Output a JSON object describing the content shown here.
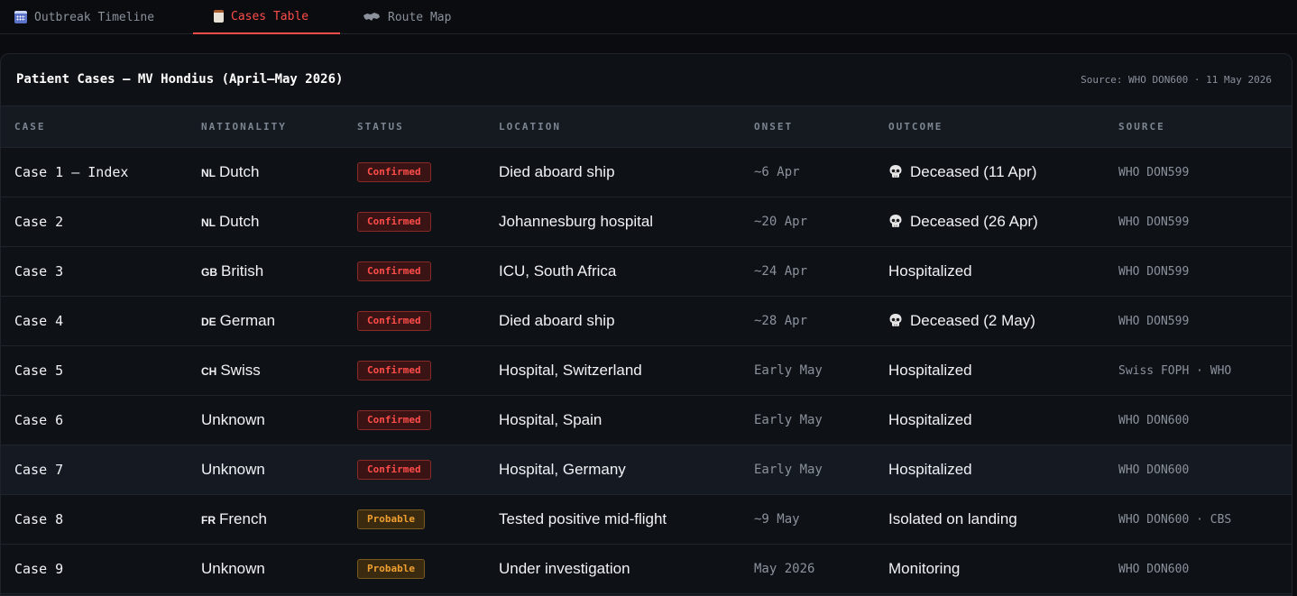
{
  "tabs": [
    {
      "label": "Outbreak Timeline",
      "icon": "calendar-icon",
      "active": false
    },
    {
      "label": "Cases Table",
      "icon": "clipboard-icon",
      "active": true
    },
    {
      "label": "Route Map",
      "icon": "map-icon",
      "active": false
    }
  ],
  "panel": {
    "title": "Patient Cases — MV Hondius (April–May 2026)",
    "source": "Source: WHO DON600 · 11 May 2026"
  },
  "table": {
    "headers": [
      "CASE",
      "NATIONALITY",
      "STATUS",
      "LOCATION",
      "ONSET",
      "OUTCOME",
      "SOURCE"
    ],
    "rows": [
      {
        "case": "Case 1 — Index",
        "flag": "NL",
        "nationality": "Dutch",
        "status": "Confirmed",
        "location": "Died aboard ship",
        "onset": "~6 Apr",
        "outcome": "Deceased (11 Apr)",
        "deceased": true,
        "source": "WHO DON599"
      },
      {
        "case": "Case 2",
        "flag": "NL",
        "nationality": "Dutch",
        "status": "Confirmed",
        "location": "Johannesburg hospital",
        "onset": "~20 Apr",
        "outcome": "Deceased (26 Apr)",
        "deceased": true,
        "source": "WHO DON599"
      },
      {
        "case": "Case 3",
        "flag": "GB",
        "nationality": "British",
        "status": "Confirmed",
        "location": "ICU, South Africa",
        "onset": "~24 Apr",
        "outcome": "Hospitalized",
        "deceased": false,
        "source": "WHO DON599"
      },
      {
        "case": "Case 4",
        "flag": "DE",
        "nationality": "German",
        "status": "Confirmed",
        "location": "Died aboard ship",
        "onset": "~28 Apr",
        "outcome": "Deceased (2 May)",
        "deceased": true,
        "source": "WHO DON599"
      },
      {
        "case": "Case 5",
        "flag": "CH",
        "nationality": "Swiss",
        "status": "Confirmed",
        "location": "Hospital, Switzerland",
        "onset": "Early May",
        "outcome": "Hospitalized",
        "deceased": false,
        "source": "Swiss FOPH · WHO"
      },
      {
        "case": "Case 6",
        "flag": "",
        "nationality": "Unknown",
        "status": "Confirmed",
        "location": "Hospital, Spain",
        "onset": "Early May",
        "outcome": "Hospitalized",
        "deceased": false,
        "source": "WHO DON600"
      },
      {
        "case": "Case 7",
        "flag": "",
        "nationality": "Unknown",
        "status": "Confirmed",
        "location": "Hospital, Germany",
        "onset": "Early May",
        "outcome": "Hospitalized",
        "deceased": false,
        "source": "WHO DON600"
      },
      {
        "case": "Case 8",
        "flag": "FR",
        "nationality": "French",
        "status": "Probable",
        "location": "Tested positive mid-flight",
        "onset": "~9 May",
        "outcome": "Isolated on landing",
        "deceased": false,
        "source": "WHO DON600 · CBS"
      },
      {
        "case": "Case 9",
        "flag": "",
        "nationality": "Unknown",
        "status": "Probable",
        "location": "Under investigation",
        "onset": "May 2026",
        "outcome": "Monitoring",
        "deceased": false,
        "source": "WHO DON600"
      }
    ]
  },
  "colors": {
    "accent": "#ff4d4a",
    "confirmed": "#ff4d4a",
    "probable": "#f0a030",
    "background": "#0a0c10"
  }
}
